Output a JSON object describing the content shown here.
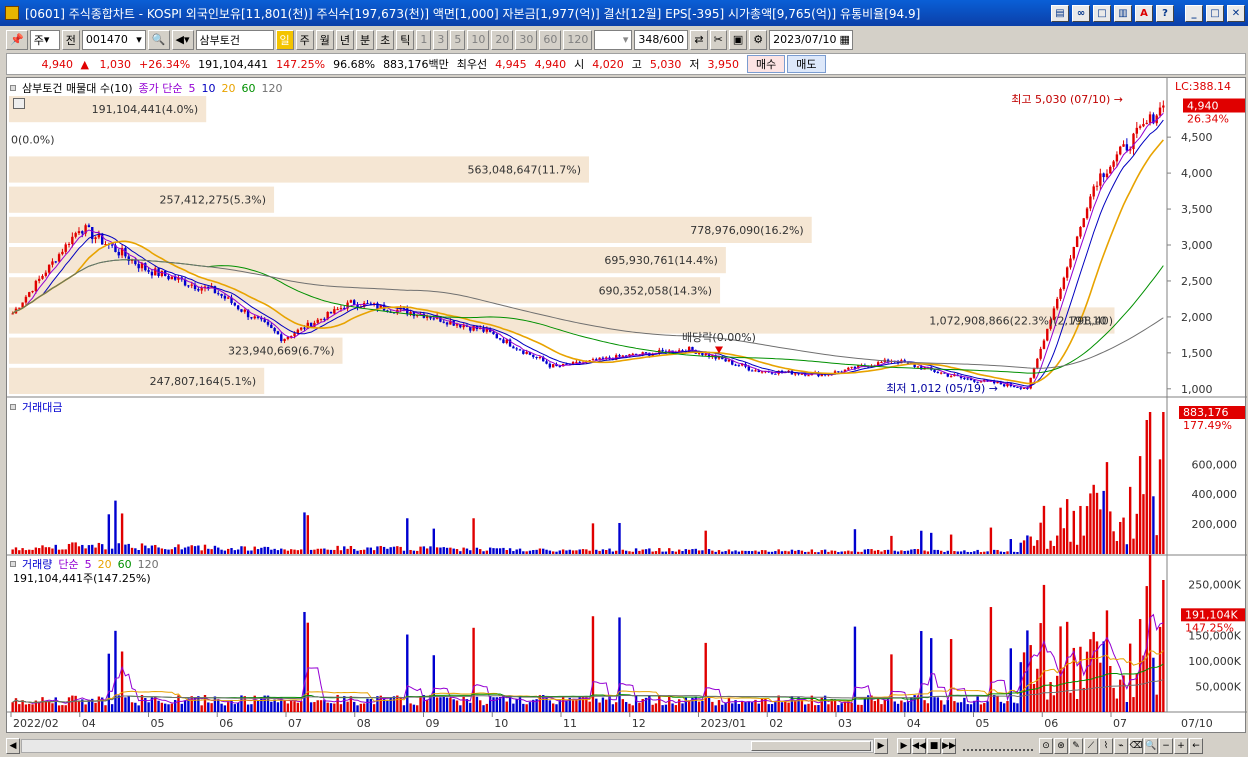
{
  "window": {
    "title": "[0601] 주식종합차트 - KOSPI 외국인보유[11,801(천)] 주식수[197,673(천)] 액면[1,000] 자본금[1,977(억)] 결산[12월] EPS[-395] 시가총액[9,765(억)] 유통비율[94.9]",
    "icons": [
      "tile-icon",
      "link-icon",
      "window-icon",
      "print-icon",
      "a-icon",
      "help-icon",
      "minimize-icon",
      "maximize-icon",
      "close-icon"
    ]
  },
  "toolbar": {
    "market": "주",
    "jeon": "전",
    "code": "001470",
    "name": "삼부토건",
    "periods": [
      "일",
      "주",
      "월",
      "년",
      "분",
      "초",
      "틱"
    ],
    "intervals": [
      "1",
      "3",
      "5",
      "10",
      "20",
      "30",
      "60",
      "120"
    ],
    "count": "348",
    "count_total": "/600",
    "date": "2023/07/10"
  },
  "quote": {
    "price": "4,940",
    "change": "1,030",
    "pct": "+26.34%",
    "volume": "191,104,441",
    "vol_pct": "147.25%",
    "ratio": "96.68%",
    "amount": "883,176백만",
    "priority_label": "최우선",
    "ask": "4,945",
    "bid": "4,940",
    "open_label": "시",
    "open": "4,020",
    "high_label": "고",
    "high": "5,030",
    "low_label": "저",
    "low": "3,950",
    "buy": "매수",
    "sell": "매도"
  },
  "colors": {
    "up": "#e00000",
    "down": "#0000d0",
    "profile": "#f5e6d3",
    "ma5": "#9400d3",
    "ma10": "#0000c0",
    "ma20": "#e8a300",
    "ma60": "#009000",
    "ma120": "#707070"
  },
  "chart": {
    "price_panel": {
      "label": "삼부토건 매물대 수(10)",
      "ma_label": "종가 단순",
      "ma_periods": [
        "5",
        "10",
        "20",
        "60",
        "120"
      ],
      "y_ticks": [
        "4,500",
        "4,000",
        "3,500",
        "3,000",
        "2,500",
        "2,000",
        "1,500",
        "1,000"
      ],
      "lc": "LC:388.14",
      "cur": "4,940",
      "cur_pct": "26.34%",
      "hi_label": "최고 5,030 (07/10)",
      "lo_label": "최저 1,012 (05/19)",
      "div_label": "배당락(0.00%)",
      "profile_bars": [
        {
          "label": "191,104,441(4.0%)",
          "frac": 0.34
        },
        {
          "label": "0(0.0%)",
          "frac": 0.0
        },
        {
          "label": "563,048,647(11.7%)",
          "frac": 1.0
        },
        {
          "label": "257,412,275(5.3%)",
          "frac": 0.457
        },
        {
          "label": "778,976,090(16.2%)",
          "frac": 1.384
        },
        {
          "label": "695,930,761(14.4%)",
          "frac": 1.236
        },
        {
          "label": "690,352,058(14.3%)",
          "frac": 1.226
        },
        {
          "label": "1,072,908,866(22.3%)(2,191,10",
          "label2": "798,40)",
          "frac": 1.906
        },
        {
          "label": "323,940,669(6.7%)",
          "frac": 0.575
        },
        {
          "label": "247,807,164(5.1%)",
          "frac": 0.44
        }
      ]
    },
    "amount_panel": {
      "label": "거래대금",
      "y_ticks": [
        "600,000",
        "400,000",
        "200,000"
      ],
      "cur": "883,176",
      "cur_pct": "177.49%"
    },
    "volume_panel": {
      "label": "거래량",
      "ma_label": "단순",
      "ma_periods": [
        "5",
        "20",
        "60",
        "120"
      ],
      "sub": "191,104,441주(147.25%)",
      "y_ticks": [
        "250,000K",
        "150,000K",
        "100,000K",
        "50,000K"
      ],
      "cur": "191,104K",
      "cur_pct": "147.25%"
    },
    "x_ticks": [
      "2022/02",
      "04",
      "05",
      "06",
      "07",
      "08",
      "09",
      "10",
      "11",
      "12",
      "2023/01",
      "02",
      "03",
      "04",
      "05",
      "06",
      "07"
    ],
    "x_end": "07/10"
  },
  "chart_data": {
    "type": "candlestick",
    "title": "삼부토건",
    "period": "2022/02 – 2023/07/10",
    "y_range": [
      900,
      5100
    ],
    "anchors": [
      [
        "2022/02",
        2050
      ],
      [
        "2022/03",
        3250
      ],
      [
        "2022/04",
        2650
      ],
      [
        "2022/05",
        2350
      ],
      [
        "2022/06",
        1700
      ],
      [
        "2022/07",
        2200
      ],
      [
        "2022/08",
        2050
      ],
      [
        "2022/09",
        1800
      ],
      [
        "2022/10",
        1300
      ],
      [
        "2022/11",
        1450
      ],
      [
        "2022/12",
        1550
      ],
      [
        "2023/01",
        1250
      ],
      [
        "2023/02",
        1200
      ],
      [
        "2023/03",
        1400
      ],
      [
        "2023/04",
        1150
      ],
      [
        "2023/05/19",
        1012
      ],
      [
        "2023/06",
        3900
      ],
      [
        "2023/07/10",
        4940
      ]
    ],
    "high": {
      "value": 5030,
      "date": "07/10"
    },
    "low": {
      "value": 1012,
      "date": "05/19"
    }
  }
}
